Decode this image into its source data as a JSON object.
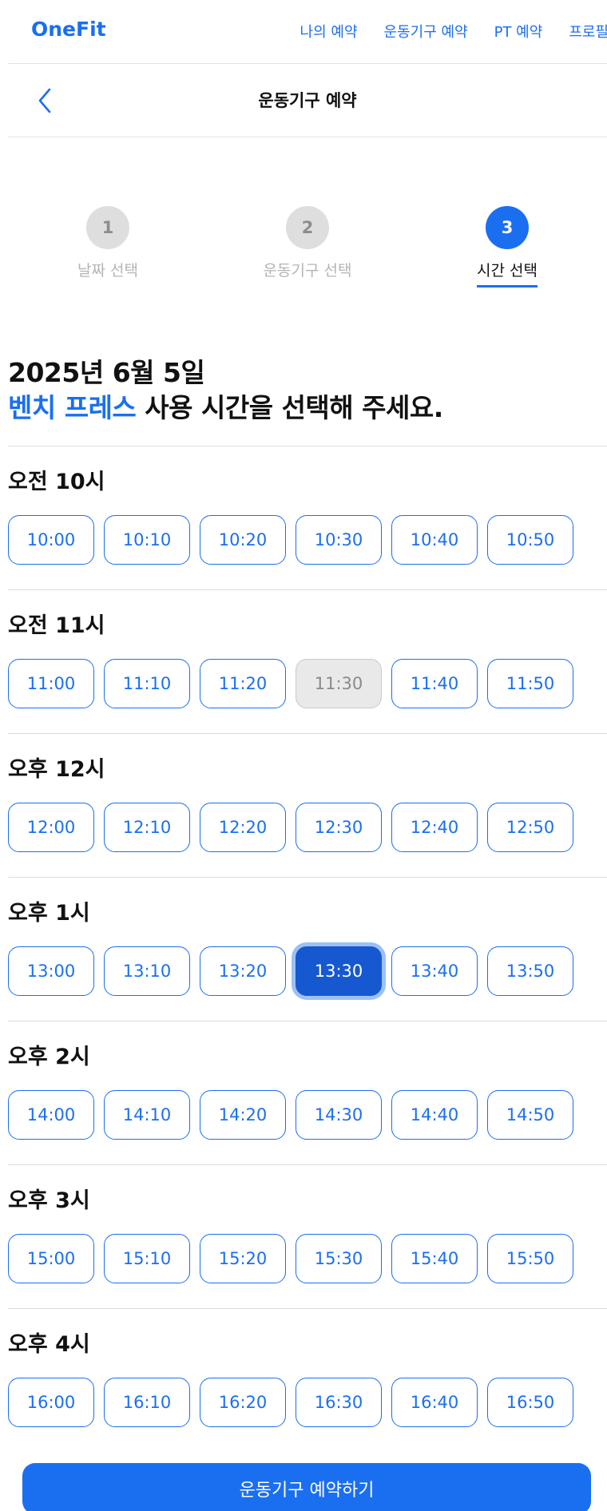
{
  "app": {
    "name": "OneFit",
    "accent": "#1a6ff0"
  },
  "nav": {
    "links": [
      "나의 예약",
      "운동기구 예약",
      "PT 예약",
      "프로필"
    ]
  },
  "header": {
    "title": "운동기구 예약",
    "back_icon": "chevron-left-icon"
  },
  "steps": [
    {
      "number": "1",
      "label": "날짜 선택",
      "state": "done"
    },
    {
      "number": "2",
      "label": "운동기구 선택",
      "state": "done"
    },
    {
      "number": "3",
      "label": "시간 선택",
      "state": "active"
    }
  ],
  "heading": {
    "date": "2025년 6월 5일",
    "equipment": "벤치 프레스",
    "prompt": " 사용 시간을 선택해 주세요."
  },
  "time_groups": [
    {
      "label": "오전 10시",
      "slots": [
        "10:00",
        "10:10",
        "10:20",
        "10:30",
        "10:40",
        "10:50"
      ]
    },
    {
      "label": "오전 11시",
      "slots": [
        "11:00",
        "11:10",
        "11:20",
        "11:30",
        "11:40",
        "11:50"
      ]
    },
    {
      "label": "오후 12시",
      "slots": [
        "12:00",
        "12:10",
        "12:20",
        "12:30",
        "12:40",
        "12:50"
      ]
    },
    {
      "label": "오후 1시",
      "slots": [
        "13:00",
        "13:10",
        "13:20",
        "13:30",
        "13:40",
        "13:50"
      ]
    },
    {
      "label": "오후 2시",
      "slots": [
        "14:00",
        "14:10",
        "14:20",
        "14:30",
        "14:40",
        "14:50"
      ]
    },
    {
      "label": "오후 3시",
      "slots": [
        "15:00",
        "15:10",
        "15:20",
        "15:30",
        "15:40",
        "15:50"
      ]
    },
    {
      "label": "오후 4시",
      "slots": [
        "16:00",
        "16:10",
        "16:20",
        "16:30",
        "16:40",
        "16:50"
      ]
    }
  ],
  "slot_states": {
    "disabled": [
      "11:30"
    ],
    "selected": "13:30"
  },
  "cta": {
    "label": "운동기구 예약하기"
  }
}
